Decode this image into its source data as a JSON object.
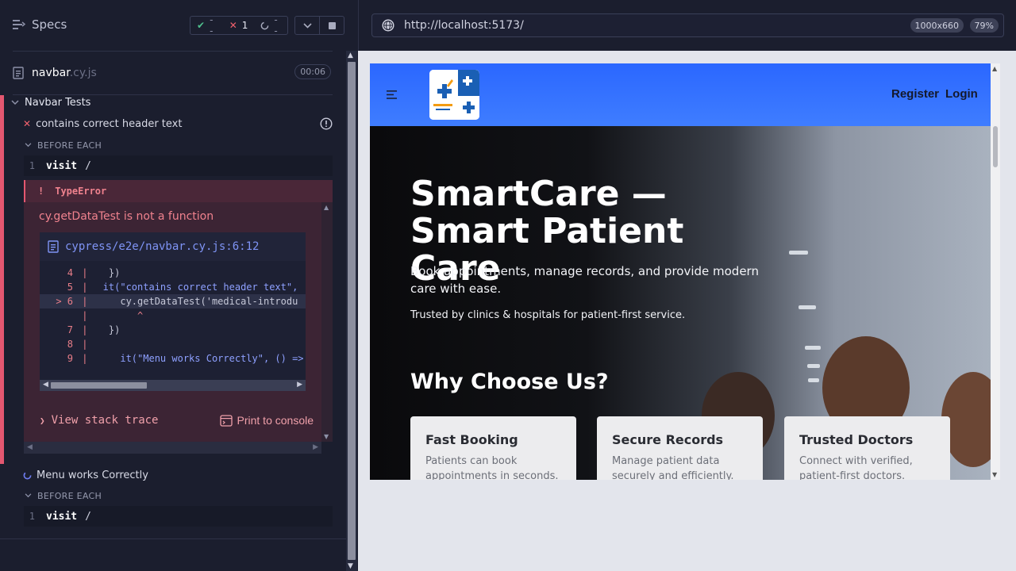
{
  "reporter": {
    "specs_label": "Specs",
    "stats": {
      "passed": "--",
      "failed": "1",
      "pending": "--"
    },
    "spec": {
      "name": "navbar",
      "ext": ".cy.js",
      "duration": "00:06"
    },
    "suite": "Navbar Tests",
    "tests": [
      {
        "title": "contains correct header text",
        "state": "failed",
        "hook": "BEFORE EACH",
        "command": {
          "num": "1",
          "name": "visit",
          "arg": "/"
        },
        "error": {
          "type": "TypeError",
          "message": "cy.getDataTest is not a function",
          "file": "cypress/e2e/navbar.cy.js:6:12",
          "code_lines": [
            {
              "gutter": "4",
              "text": "    })"
            },
            {
              "gutter": "5",
              "text": "   it(\"contains correct header text\","
            },
            {
              "gutter": "> 6",
              "text": "      cy.getDataTest('medical-introdu"
            },
            {
              "gutter": "",
              "text": "         ^"
            },
            {
              "gutter": "7",
              "text": "    })"
            },
            {
              "gutter": "8",
              "text": ""
            },
            {
              "gutter": "9",
              "text": "      it(\"Menu works Correctly\", () =>"
            }
          ],
          "stack_label": "View stack trace",
          "print_label": "Print to console"
        }
      },
      {
        "title": "Menu works Correctly",
        "state": "running",
        "hook": "BEFORE EACH",
        "command": {
          "num": "1",
          "name": "visit",
          "arg": "/"
        }
      }
    ]
  },
  "browser": {
    "url": "http://localhost:5173/",
    "viewport_size": "1000x660",
    "zoom": "79%"
  },
  "app": {
    "nav": {
      "register": "Register",
      "login": "Login"
    },
    "hero_title": "SmartCare — Smart Patient Care",
    "hero_lead": "Book appointments, manage records, and provide modern care with ease.",
    "hero_trust": "Trusted by clinics & hospitals for patient-first service.",
    "section_title": "Why Choose Us?",
    "cards": [
      {
        "title": "Fast Booking",
        "text": "Patients can book appointments in seconds."
      },
      {
        "title": "Secure Records",
        "text": "Manage patient data securely and efficiently."
      },
      {
        "title": "Trusted Doctors",
        "text": "Connect with verified, patient-first doctors."
      }
    ]
  },
  "colors": {
    "fail": "#e45770",
    "pass": "#4fc08d",
    "link": "#7f94f5",
    "nav_blue": "#2b67ff"
  },
  "icons": [
    "specs-list-icon",
    "check-icon",
    "x-icon",
    "spinner-icon",
    "chevron-down-icon",
    "stop-icon",
    "file-icon",
    "alert-circle-icon",
    "globe-icon",
    "hamburger-icon",
    "terminal-icon"
  ]
}
